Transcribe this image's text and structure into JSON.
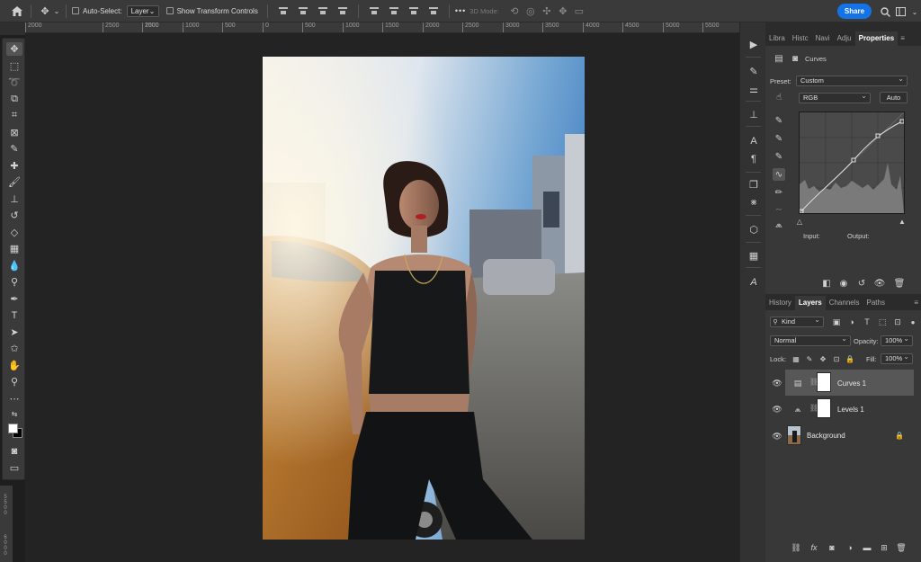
{
  "options_bar": {
    "auto_select_label": "Auto-Select:",
    "auto_select_target": "Layer",
    "show_transform_label": "Show Transform Controls",
    "mode_3d_label": "3D Mode:",
    "share_label": "Share",
    "more_label": "•••"
  },
  "ruler": {
    "ticks": [
      "2000",
      "2500",
      "2000",
      "1500",
      "1000",
      "500",
      "0",
      "500",
      "1000",
      "1500",
      "2000",
      "2500",
      "3000",
      "3500",
      "4000",
      "4500",
      "5000",
      "5500"
    ],
    "left_ticks": [
      "5500",
      "6000"
    ]
  },
  "panels": {
    "top_tabs": [
      "Libra",
      "Histc",
      "Navi",
      "Adju",
      "Properties"
    ],
    "properties": {
      "title": "Curves",
      "preset_label": "Preset:",
      "preset_value": "Custom",
      "channel_value": "RGB",
      "auto_label": "Auto",
      "input_label": "Input:",
      "output_label": "Output:"
    },
    "bottom_tabs": [
      "History",
      "Layers",
      "Channels",
      "Paths"
    ],
    "layers": {
      "filter_kind": "Kind",
      "blend_mode": "Normal",
      "opacity_label": "Opacity:",
      "opacity_value": "100%",
      "lock_label": "Lock:",
      "fill_label": "Fill:",
      "fill_value": "100%",
      "items": [
        {
          "name": "Curves 1",
          "selected": true
        },
        {
          "name": "Levels 1",
          "selected": false
        },
        {
          "name": "Background",
          "selected": false
        }
      ]
    }
  },
  "icons": {
    "home": "home-icon",
    "move": "move-icon",
    "search": "search-icon",
    "workspace": "workspace-icon",
    "gear": "gear-icon"
  },
  "colors": {
    "accent": "#1473e6",
    "foreground_swatch": "#ffffff",
    "background_swatch": "#000000"
  }
}
